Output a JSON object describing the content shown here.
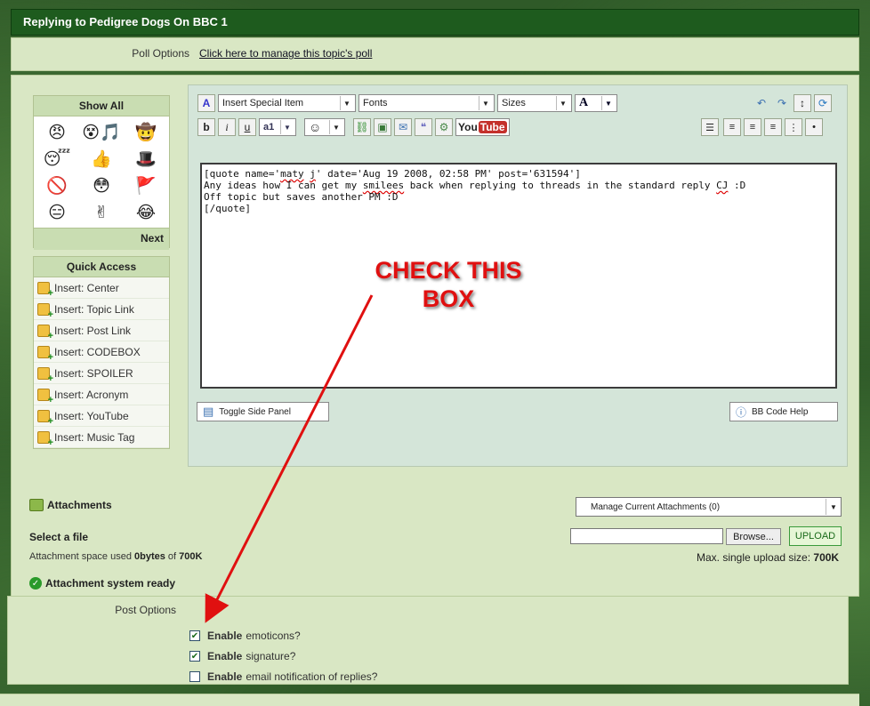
{
  "titlebar": {
    "title": "Replying to Pedigree Dogs On BBC 1"
  },
  "poll": {
    "label": "Poll Options",
    "link": "Click here to manage this topic's poll"
  },
  "smilies": {
    "header": "Show All",
    "next": "Next",
    "icons": [
      "angry-smiley-icon",
      "singing-smiley-icon",
      "cowboy-guns-smiley-icon",
      "sleepy-smiley-icon",
      "thumbsup-smiley-icon",
      "bowler-hat-smiley-icon",
      "censored-smiley-icon",
      "blank-stare-smiley-icon",
      "flag-smiley-icon",
      "meh-smiley-icon",
      "peace-smiley-icon",
      "laughing-smiley-icon"
    ],
    "glyphs": [
      "😠",
      "😵🎵",
      "🤠",
      "😴",
      "👍",
      "🎩",
      "🚫",
      "😳",
      "🚩",
      "😑",
      "✌",
      "😂"
    ]
  },
  "quick_access": {
    "header": "Quick Access",
    "items": [
      "Insert: Center",
      "Insert: Topic Link",
      "Insert: Post Link",
      "Insert: CODEBOX",
      "Insert: SPOILER",
      "Insert: Acronym",
      "Insert: YouTube",
      "Insert: Music Tag"
    ]
  },
  "toolbar": {
    "special_item": "Insert Special Item",
    "fonts": "Fonts",
    "sizes": "Sizes",
    "font_color": "A",
    "bold": "b",
    "italic": "i",
    "underline": "u",
    "youtube_a": "You",
    "youtube_b": "Tube"
  },
  "editor": {
    "line1_a": "[quote name='",
    "line1_name_a": "maty",
    "line1_name_b": "j",
    "line1_b": "' date='Aug 19 2008, 02:58 PM' post='631594']",
    "line2_a": "Any ideas how I can get my ",
    "line2_word": "smilees",
    "line2_b": " back when replying to threads in the standard reply ",
    "line2_cj": "CJ",
    "line2_c": " :D",
    "line3": "Off topic but saves another PM :D",
    "line4": "[/quote]"
  },
  "buttons": {
    "toggle_side": "Toggle Side Panel",
    "bbcode_help": "BB Code Help"
  },
  "attachments": {
    "title": "Attachments",
    "manage": "Manage Current Attachments (0)",
    "select_file": "Select a file",
    "browse": "Browse...",
    "upload": "UPLOAD",
    "space_prefix": "Attachment space used ",
    "space_used": "0bytes",
    "space_of": " of ",
    "space_total": "700K",
    "max_prefix": "Max. single upload size: ",
    "max_value": "700K",
    "ready": "Attachment system ready"
  },
  "post_options": {
    "label": "Post Options",
    "options": [
      {
        "bold": "Enable",
        "rest": "emoticons?",
        "checked": true
      },
      {
        "bold": "Enable",
        "rest": "signature?",
        "checked": true
      },
      {
        "bold": "Enable",
        "rest": "email notification of replies?",
        "checked": false
      }
    ]
  },
  "annotation": {
    "line1": "CHECK THIS",
    "line2": "BOX"
  },
  "colors": {
    "title_bg": "#1e5b1e",
    "panel_bg": "#d9e7c4",
    "annotation": "#e01010"
  }
}
